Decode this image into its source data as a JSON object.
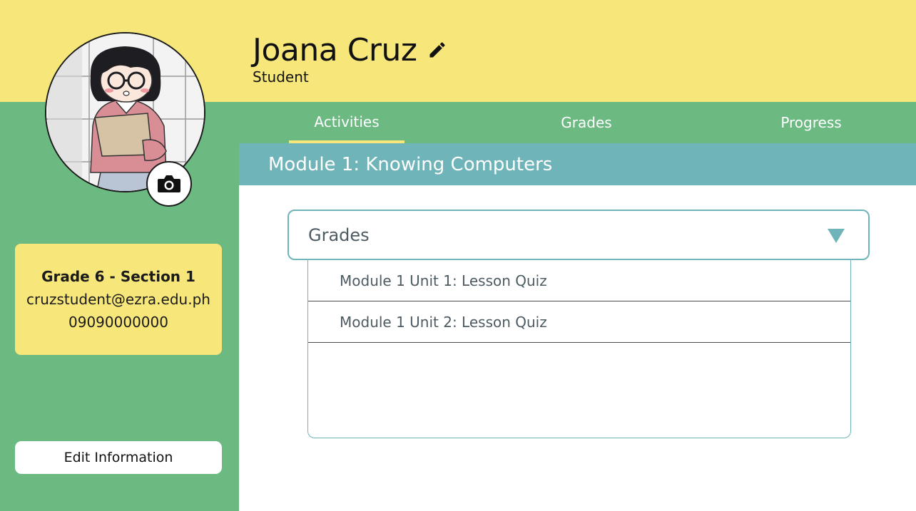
{
  "profile": {
    "name": "Joana Cruz",
    "role": "Student"
  },
  "tabs": [
    {
      "label": "Activities",
      "active": true
    },
    {
      "label": "Grades",
      "active": false
    },
    {
      "label": "Progress",
      "active": false
    }
  ],
  "module": {
    "title": "Module 1: Knowing Computers"
  },
  "info": {
    "section": "Grade 6 - Section 1",
    "email": "cruzstudent@ezra.edu.ph",
    "phone": "09090000000"
  },
  "edit_button": "Edit Information",
  "dropdown": {
    "selected": "Grades",
    "items": [
      "Module 1 Unit 1: Lesson Quiz",
      "Module 1 Unit 2: Lesson Quiz"
    ]
  },
  "colors": {
    "yellow": "#f7e77a",
    "green": "#6db982",
    "teal": "#6fb4b8"
  },
  "icons": {
    "edit": "pencil-icon",
    "camera": "camera-icon",
    "caret": "triangle-down-icon"
  }
}
